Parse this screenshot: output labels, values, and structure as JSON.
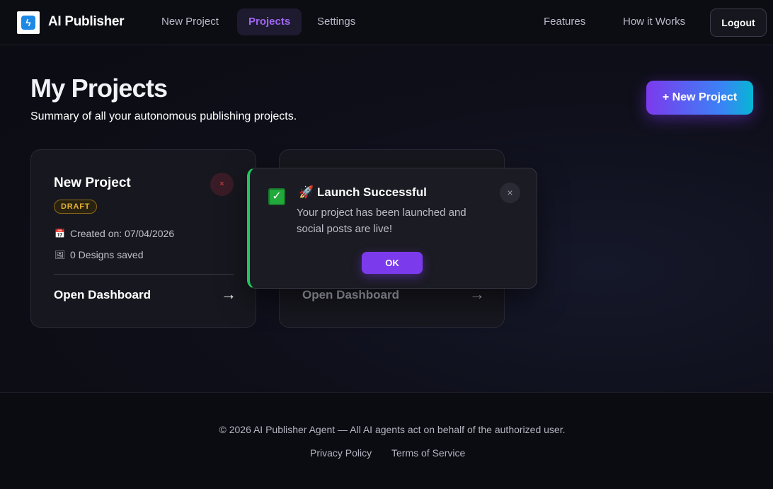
{
  "nav": {
    "brand": "AI Publisher",
    "logo_icon": "bolt-icon",
    "links": [
      "New Project",
      "Projects",
      "Settings"
    ],
    "active": "Projects",
    "right_links": [
      "Features",
      "How it Works"
    ],
    "logout": "Logout"
  },
  "header": {
    "title": "My Projects",
    "subtitle": "Summary of all your autonomous publishing projects.",
    "new_project_button": "+ New Project"
  },
  "cards": [
    {
      "title": "New Project",
      "status": "DRAFT",
      "created": "Created on: 07/04/2026",
      "designs": "0 Designs saved",
      "open_label": "Open Dashboard",
      "arrow": "→",
      "delete_icon": "×"
    },
    {
      "open_label": "Open Dashboard",
      "arrow": "→"
    }
  ],
  "toast": {
    "title": "🚀 Launch Successful",
    "message": "Your project has been launched and social posts are live!",
    "ok": "OK",
    "close": "×",
    "check": "✓",
    "accent_color": "#22c55e"
  },
  "footer": {
    "copyright": "© 2026 AI Publisher Agent — All AI agents act on behalf of the authorized user.",
    "links": [
      "Privacy Policy",
      "Terms of Service"
    ]
  },
  "colors": {
    "primary": "#7c3aed",
    "gradient_end": "#06b6d4",
    "draft_badge": "#e3b234",
    "danger": "#e04848"
  }
}
